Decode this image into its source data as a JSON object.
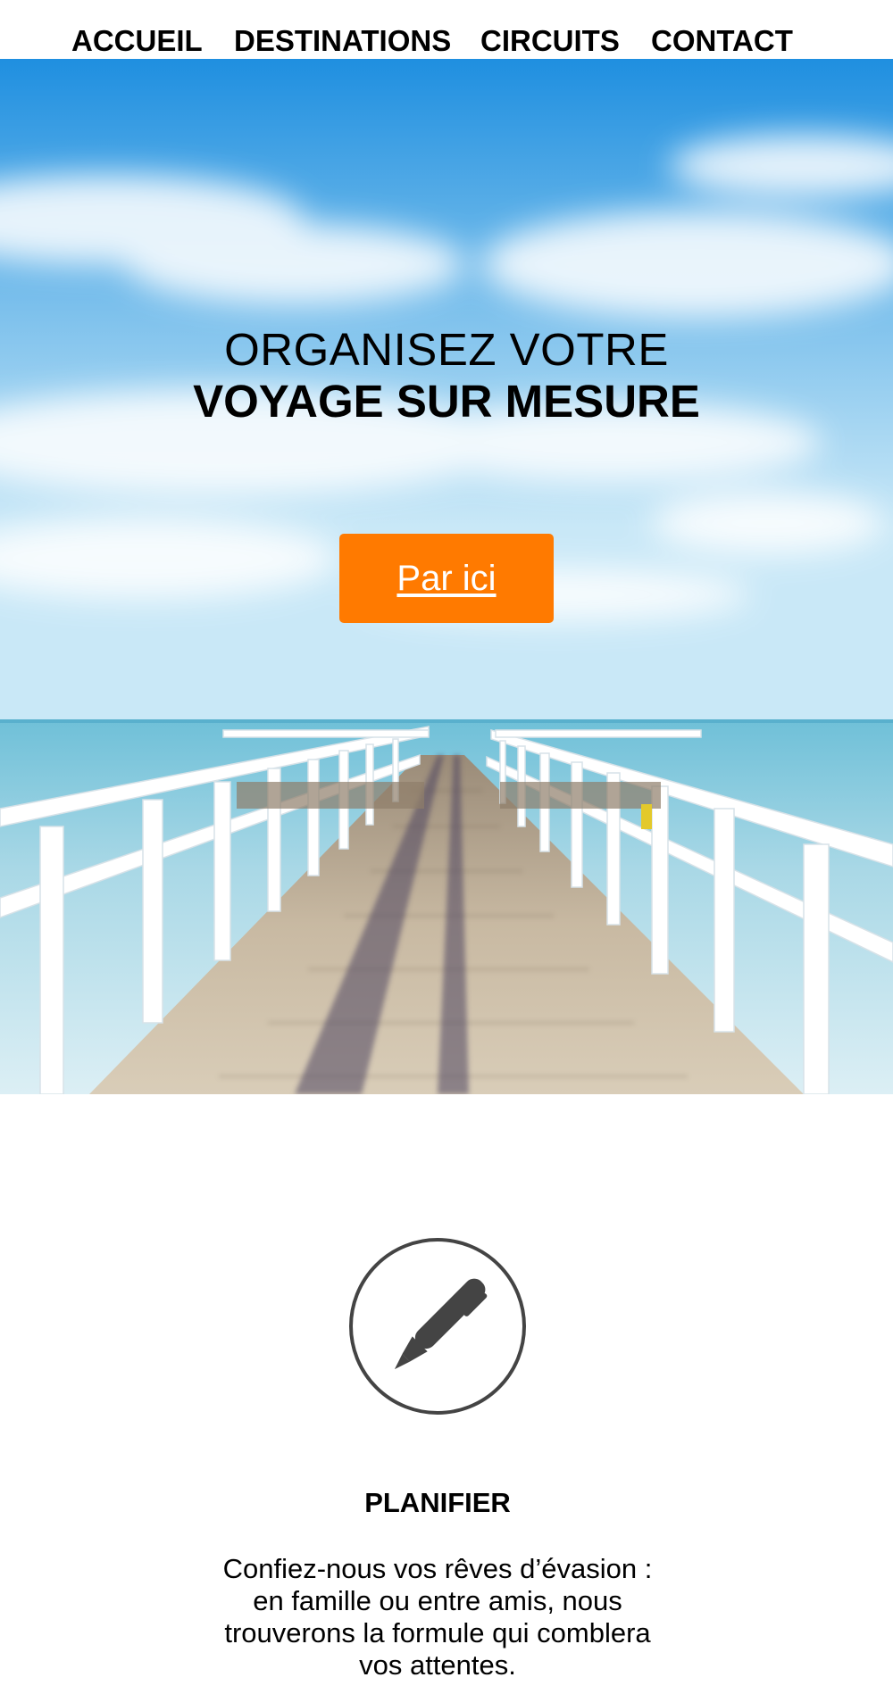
{
  "nav": {
    "items": [
      {
        "label": "ACCUEIL"
      },
      {
        "label": "DESTINATIONS"
      },
      {
        "label": "CIRCUITS"
      },
      {
        "label": "CONTACT"
      }
    ]
  },
  "hero": {
    "title_line1": "ORGANISEZ VOTRE",
    "title_line2": "VOYAGE SUR MESURE",
    "cta_label": "Par ici",
    "cta_color": "#ff7a00"
  },
  "feature": {
    "icon": "pen-icon",
    "title": "PLANIFIER",
    "text": "Confiez-nous vos rêves d’évasion : en famille ou entre amis, nous trouverons la formule qui comblera vos attentes."
  }
}
